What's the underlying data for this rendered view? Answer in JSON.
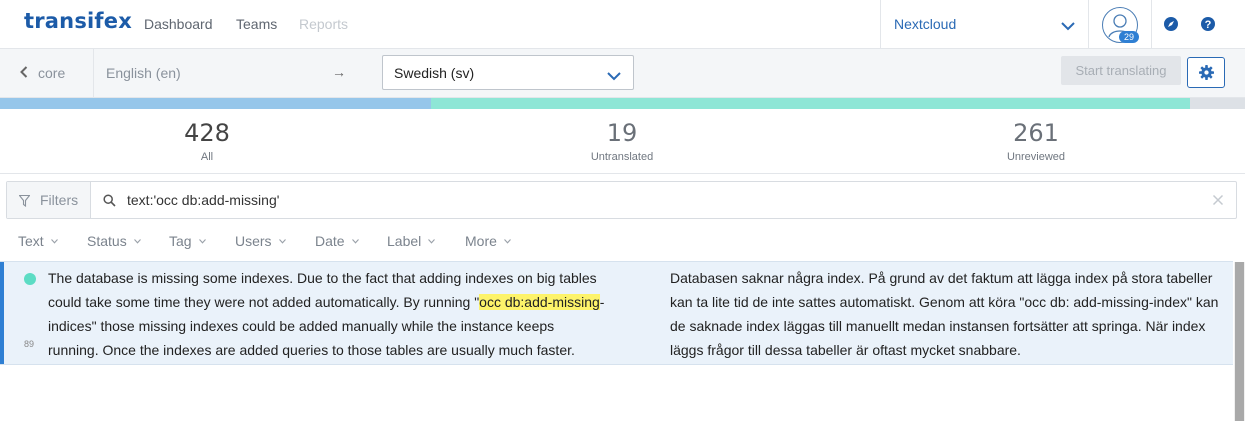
{
  "nav": {
    "logo": "transifex",
    "links": [
      "Dashboard",
      "Teams",
      "Reports"
    ],
    "organization": "Nextcloud",
    "avatar_badge": "29",
    "accent_color": "#2a6ab5"
  },
  "project_bar": {
    "back_label": "core",
    "source_language": "English (en)",
    "arrow": "→",
    "target_language": "Swedish (sv)",
    "start_button": "Start translating"
  },
  "progress": {
    "reviewed_fraction": 0.346,
    "translated_fraction": 0.61,
    "colors": {
      "reviewed": "#96c6ea",
      "translated": "#8ee6d6",
      "remaining": "#dde1e6"
    }
  },
  "stats": {
    "all": {
      "value": "428",
      "label": "All"
    },
    "untranslated": {
      "value": "19",
      "label": "Untranslated"
    },
    "unreviewed": {
      "value": "261",
      "label": "Unreviewed"
    }
  },
  "filter": {
    "button_label": "Filters",
    "query": "text:'occ db:add-missing'"
  },
  "facets": [
    "Text",
    "Status",
    "Tag",
    "Users",
    "Date",
    "Label",
    "More"
  ],
  "string_row": {
    "number": "89",
    "source_before": "The database is missing some indexes. Due to the fact that adding indexes on big tables could take some time they were not added automatically. By running \"",
    "source_highlight": "occ db:add-missing",
    "source_after": "-indices\" those missing indexes could be added manually while the instance keeps running. Once the indexes are added queries to those tables are usually much faster.",
    "translation": "Databasen saknar några index. På grund av det faktum att lägga index på stora tabeller kan ta lite tid de inte sattes automatiskt. Genom att köra \"occ db: add-missing-index\" kan de saknade index läggas till manuellt medan instansen fortsätter att springa. När index läggs frågor till dessa tabeller är oftast mycket snabbare."
  },
  "icons": [
    "back-chevron-icon",
    "chevron-down-icon",
    "user-avatar-icon",
    "compass-icon",
    "help-icon",
    "gear-icon",
    "filter-icon",
    "search-icon",
    "close-icon"
  ]
}
